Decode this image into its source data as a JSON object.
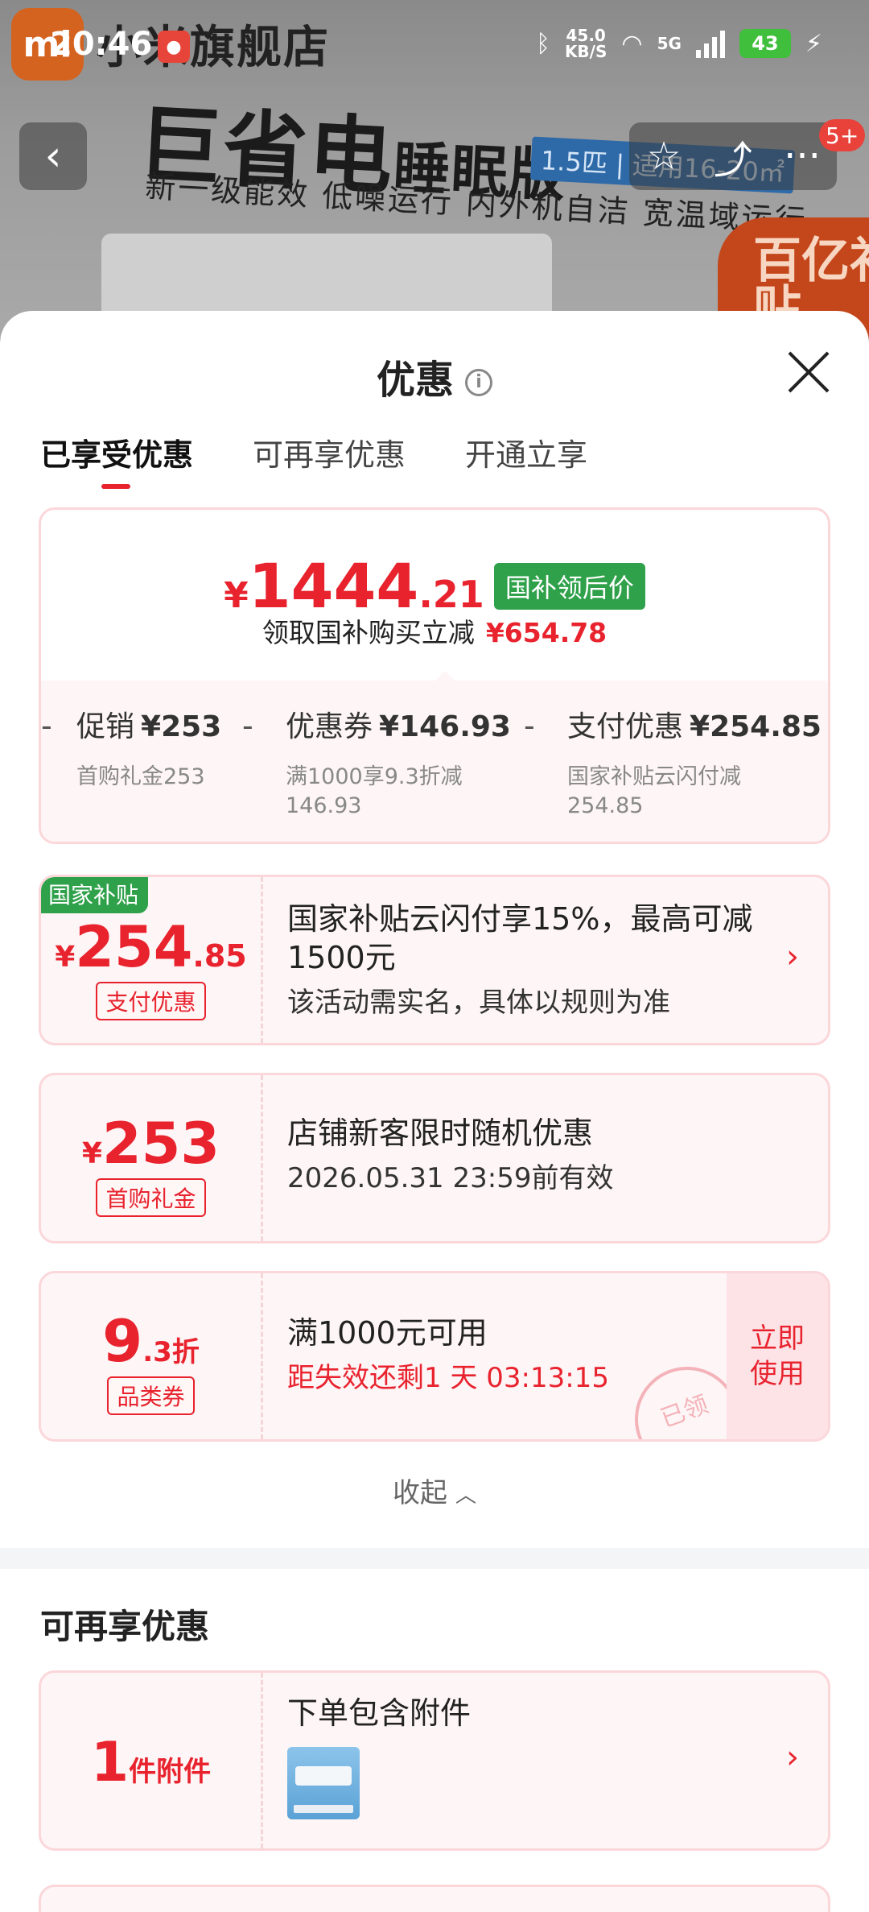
{
  "status": {
    "time": "20:46",
    "speed_value": "45.0",
    "speed_unit": "KB/S",
    "network": "5G",
    "battery": "43"
  },
  "background": {
    "shop_name": "小米旗舰店",
    "logo_text": "mi",
    "headline_big": "巨省电",
    "headline_small": "睡眠版",
    "spec_tag": "1.5匹 | 适用16-20㎡",
    "features": "新一级能效  低噪运行  内外机自洁  宽温域运行",
    "badge": "百亿补贴",
    "cart_count": "5+"
  },
  "sheet": {
    "title": "优惠",
    "tabs": [
      "已享受优惠",
      "可再享优惠",
      "开通立享"
    ]
  },
  "summary": {
    "price_currency": "¥",
    "price_int": "1444",
    "price_dec": ".21",
    "price_tag": "国补领后价",
    "save_text": "领取国补购买立减",
    "save_amount": "¥654.78",
    "items": [
      {
        "label": "促销",
        "amount": "¥253",
        "desc": "首购礼金253"
      },
      {
        "label": "优惠券",
        "amount": "¥146.93",
        "desc": "满1000享9.3折减\n146.93"
      },
      {
        "label": "支付优惠",
        "amount": "¥254.85",
        "desc": "国家补贴云闪付减\n254.85"
      }
    ]
  },
  "cards": [
    {
      "corner": "国家补贴",
      "amount_cur": "¥",
      "amount_int": "254",
      "amount_dec": ".85",
      "chip": "支付优惠",
      "title": "国家补贴云闪付享15%，最高可减1500元",
      "sub": "该活动需实名，具体以规则为准"
    },
    {
      "amount_cur": "¥",
      "amount_int": "253",
      "chip": "首购礼金",
      "title": "店铺新客限时随机优惠",
      "sub": "2026.05.31 23:59前有效"
    },
    {
      "amount_int": "9",
      "amount_dec": ".3折",
      "chip": "品类券",
      "title": "满1000元可用",
      "red": "距失效还剩1 天 03:13:15",
      "button": "立即使用",
      "stamp": "已领"
    }
  ],
  "collapse_label": "收起",
  "more_section": {
    "title": "可再享优惠",
    "card": {
      "amount_int": "1",
      "amount_unit": "件附件",
      "title": "下单包含附件"
    }
  }
}
